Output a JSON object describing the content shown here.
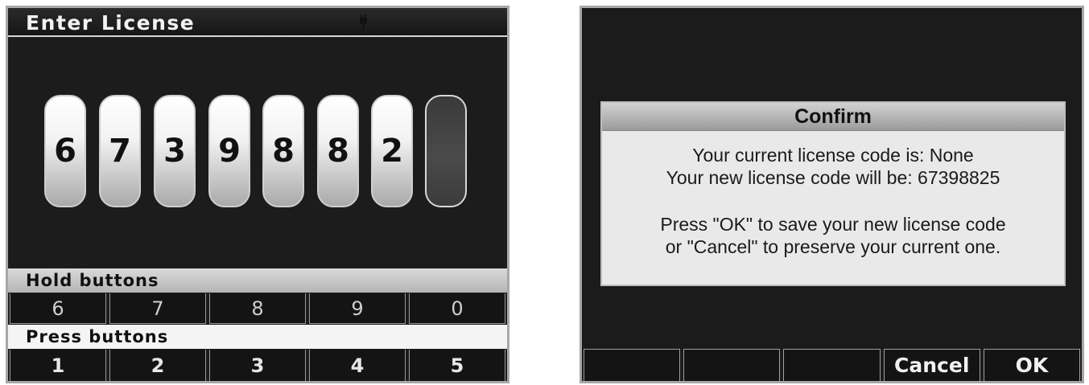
{
  "left_screen": {
    "title": "Enter License",
    "digits": [
      "6",
      "7",
      "3",
      "9",
      "8",
      "8",
      "2",
      ""
    ],
    "hold_label": "Hold buttons",
    "hold_keys": [
      "6",
      "7",
      "8",
      "9",
      "0"
    ],
    "press_label": "Press buttons",
    "press_keys": [
      "1",
      "2",
      "3",
      "4",
      "5"
    ]
  },
  "right_screen": {
    "dialog": {
      "title": "Confirm",
      "line1": "Your current license code is: None",
      "line2": "Your new license code will be: 67398825",
      "line3": "Press \"OK\" to save your new license code",
      "line4": "or \"Cancel\" to preserve your current one."
    },
    "softkeys": [
      "",
      "",
      "",
      "Cancel",
      "OK"
    ]
  }
}
